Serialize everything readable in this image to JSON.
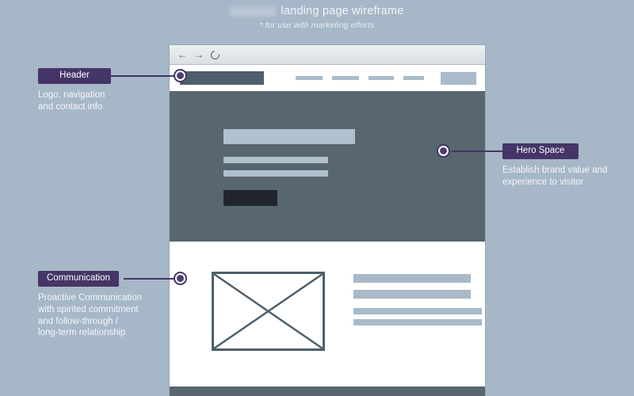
{
  "title": {
    "redacted_prefix": true,
    "main": "landing page wireframe",
    "subtitle": "* for use with marketing efforts"
  },
  "browser": {
    "chrome_icons": [
      "back-arrow-icon",
      "forward-arrow-icon",
      "reload-icon"
    ],
    "back_glyph": "←",
    "forward_glyph": "→"
  },
  "wireframe": {
    "header": {
      "logo_label": "",
      "nav_link_widths": [
        34,
        34,
        32,
        26
      ],
      "cta_label": ""
    },
    "hero": {
      "heading_label": "",
      "line_labels": [
        "",
        ""
      ],
      "cta_label": ""
    },
    "content": {
      "image_placeholder_label": "",
      "line_widths": [
        148,
        148,
        162,
        162
      ]
    }
  },
  "callouts": [
    {
      "id": "header",
      "badge": "Header",
      "description": "Logo, navigation\nand contact info"
    },
    {
      "id": "hero",
      "badge": "Hero Space",
      "description": "Establish brand value and\nexperience to visitor"
    },
    {
      "id": "communication",
      "badge": "Communication",
      "description": "Proactive Communication\nwith spirited commitment\nand follow-through /\nlong-term relationship"
    }
  ],
  "colors": {
    "background": "#a6b7c7",
    "accent_purple": "#453567",
    "slate_dark": "#57666f",
    "slate_mid": "#4e5f6b",
    "bar_light": "#a8b9c8",
    "cta_dark": "#21262d",
    "text_light": "#f4f7fa"
  }
}
